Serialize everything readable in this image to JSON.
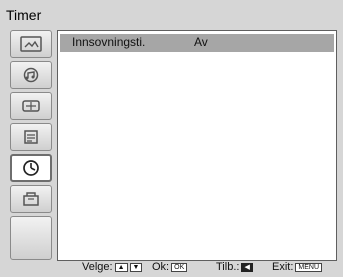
{
  "window": {
    "title": "Timer"
  },
  "sidebar": {
    "items": [
      {
        "name": "picture-icon"
      },
      {
        "name": "sound-icon"
      },
      {
        "name": "screen-control-icon"
      },
      {
        "name": "features-icon"
      },
      {
        "name": "timer-icon",
        "selected": true
      },
      {
        "name": "setup-icon"
      },
      {
        "name": "blank-item"
      }
    ]
  },
  "menu": {
    "row_label": "Innsovningsti.",
    "row_value": "Av"
  },
  "footer": {
    "select_label": "Velge:",
    "ok_label": "Ok:",
    "ok_key": "OK",
    "back_label": "Tilb.:",
    "exit_label": "Exit:",
    "menu_key": "MENU"
  },
  "colors": {
    "background": "#d6d6d6",
    "panel": "#ffffff",
    "highlight": "#a6a6a6",
    "border": "#5f5f5f"
  }
}
